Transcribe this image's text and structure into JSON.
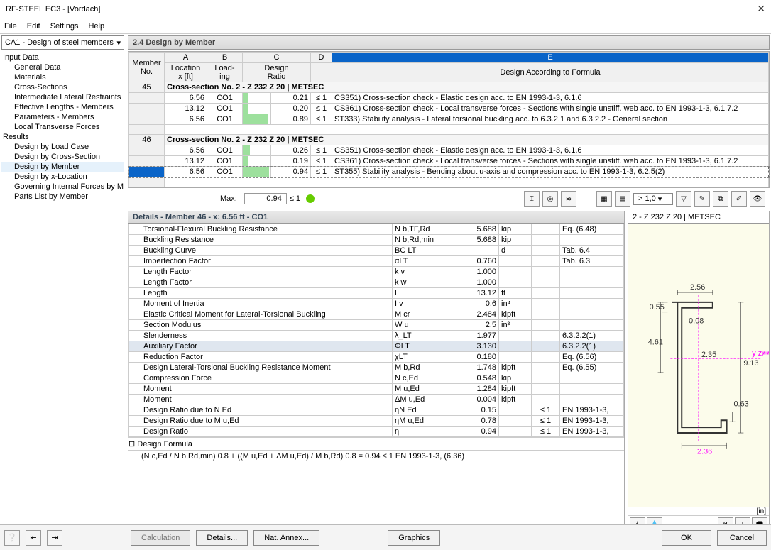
{
  "window": {
    "title": "RF-STEEL EC3 - [Vordach]",
    "close": "✕"
  },
  "menu": [
    "File",
    "Edit",
    "Settings",
    "Help"
  ],
  "caseDropdown": "CA1 - Design of steel members",
  "tree": {
    "groups": [
      {
        "label": "Input Data",
        "items": [
          "General Data",
          "Materials",
          "Cross-Sections",
          "Intermediate Lateral Restraints",
          "Effective Lengths - Members",
          "Parameters - Members",
          "Local Transverse Forces"
        ]
      },
      {
        "label": "Results",
        "items": [
          "Design by Load Case",
          "Design by Cross-Section",
          "Design by Member",
          "Design by x-Location",
          "Governing Internal Forces by M",
          "Parts List by Member"
        ]
      }
    ],
    "selected": "Design by Member"
  },
  "section": "2.4 Design by Member",
  "cols": {
    "A": "A",
    "B": "B",
    "C": "C",
    "D": "D",
    "E": "E",
    "member": "Member",
    "no": "No.",
    "loc": "Location",
    "xft": "x [ft]",
    "load": "Load-",
    "ing": "ing",
    "design": "Design",
    "ratio": "Ratio",
    "formula": "Design According to Formula"
  },
  "groups": [
    {
      "no": "45",
      "head": "Cross-section No.  2 - Z 232 Z 20 | METSEC",
      "rows": [
        {
          "x": "6.56",
          "l": "CO1",
          "r": "0.21",
          "rbar": 0.21,
          "lim": "≤ 1",
          "f": "CS351) Cross-section check - Elastic design acc. to EN 1993-1-3, 6.1.6"
        },
        {
          "x": "13.12",
          "l": "CO1",
          "r": "0.20",
          "rbar": 0.2,
          "lim": "≤ 1",
          "f": "CS361) Cross-section check - Local transverse forces - Sections with single unstiff. web acc. to EN 1993-1-3, 6.1.7.2"
        },
        {
          "x": "6.56",
          "l": "CO1",
          "r": "0.89",
          "rbar": 0.89,
          "lim": "≤ 1",
          "f": "ST333) Stability analysis - Lateral torsional buckling acc. to 6.3.2.1 and 6.3.2.2 - General section"
        }
      ]
    },
    {
      "no": "46",
      "head": "Cross-section No.  2 - Z 232 Z 20 | METSEC",
      "rows": [
        {
          "x": "6.56",
          "l": "CO1",
          "r": "0.26",
          "rbar": 0.26,
          "lim": "≤ 1",
          "f": "CS351) Cross-section check - Elastic design acc. to EN 1993-1-3, 6.1.6"
        },
        {
          "x": "13.12",
          "l": "CO1",
          "r": "0.19",
          "rbar": 0.19,
          "lim": "≤ 1",
          "f": "CS361) Cross-section check - Local transverse forces - Sections with single unstiff. web acc. to EN 1993-1-3, 6.1.7.2"
        },
        {
          "x": "6.56",
          "l": "CO1",
          "r": "0.94",
          "rbar": 0.94,
          "lim": "≤ 1",
          "f": "ST355) Stability analysis - Bending about u-axis and compression acc. to EN 1993-1-3, 6.2.5(2)",
          "sel": true
        }
      ]
    }
  ],
  "max": {
    "label": "Max:",
    "value": "0.94",
    "lim": "≤ 1"
  },
  "tbSelect": "> 1,0",
  "details": {
    "header": "Details - Member 46 - x: 6.56 ft - CO1",
    "rows": [
      [
        "Torsional-Flexural Buckling Resistance",
        "N b,TF,Rd",
        "5.688",
        "kip",
        "",
        "Eq. (6.48)"
      ],
      [
        "Buckling Resistance",
        "N b,Rd,min",
        "5.688",
        "kip",
        "",
        ""
      ],
      [
        "Buckling Curve",
        "BC LT",
        "",
        "d",
        "",
        "Tab. 6.4"
      ],
      [
        "Imperfection Factor",
        "αLT",
        "0.760",
        "",
        "",
        "Tab. 6.3"
      ],
      [
        "Length Factor",
        "k v",
        "1.000",
        "",
        "",
        ""
      ],
      [
        "Length Factor",
        "k w",
        "1.000",
        "",
        "",
        ""
      ],
      [
        "Length",
        "L",
        "13.12",
        "ft",
        "",
        ""
      ],
      [
        "Moment of Inertia",
        "I v",
        "0.6",
        "in⁴",
        "",
        ""
      ],
      [
        "Elastic Critical Moment for Lateral-Torsional Buckling",
        "M cr",
        "2.484",
        "kipft",
        "",
        ""
      ],
      [
        "Section Modulus",
        "W u",
        "2.5",
        "in³",
        "",
        ""
      ],
      [
        "Slenderness",
        "λ_LT",
        "1.977",
        "",
        "",
        "6.3.2.2(1)"
      ],
      [
        "Auxiliary Factor",
        "ΦLT",
        "3.130",
        "",
        "",
        "6.3.2.2(1)"
      ],
      [
        "Reduction Factor",
        "χLT",
        "0.180",
        "",
        "",
        "Eq. (6.56)"
      ],
      [
        "Design Lateral-Torsional Buckling Resistance Moment",
        "M b,Rd",
        "1.748",
        "kipft",
        "",
        "Eq. (6.55)"
      ],
      [
        "Compression Force",
        "N c,Ed",
        "0.548",
        "kip",
        "",
        ""
      ],
      [
        "Moment",
        "M u,Ed",
        "1.284",
        "kipft",
        "",
        ""
      ],
      [
        "Moment",
        "ΔM u,Ed",
        "0.004",
        "kipft",
        "",
        ""
      ],
      [
        "Design Ratio due to N Ed",
        "ηN Ed",
        "0.15",
        "",
        "≤ 1",
        "EN 1993-1-3,"
      ],
      [
        "Design Ratio due to M u,Ed",
        "ηM u,Ed",
        "0.78",
        "",
        "≤ 1",
        "EN 1993-1-3,"
      ],
      [
        "Design Ratio",
        "η",
        "0.94",
        "",
        "≤ 1",
        "EN 1993-1-3,"
      ]
    ],
    "formulaHdr": "Design Formula",
    "formula": "(N c,Ed / N b,Rd,min) 0.8 + ((M u,Ed + ΔM u,Ed) / M b,Rd) 0.8 = 0.94 ≤ 1   EN 1993-1-3, (6.36)",
    "highlight": 11
  },
  "diagram": {
    "title": "2 - Z 232 Z 20 | METSEC",
    "dims": {
      "a": "2.56",
      "b": "0.55",
      "c": "0.08",
      "d": "2.35",
      "e": "9.13",
      "f": "4.61",
      "g": "0.63",
      "h": "2.36"
    },
    "unit": "[in]"
  },
  "buttons": {
    "calc": "Calculation",
    "details": "Details...",
    "annex": "Nat. Annex...",
    "graphics": "Graphics",
    "ok": "OK",
    "cancel": "Cancel"
  }
}
